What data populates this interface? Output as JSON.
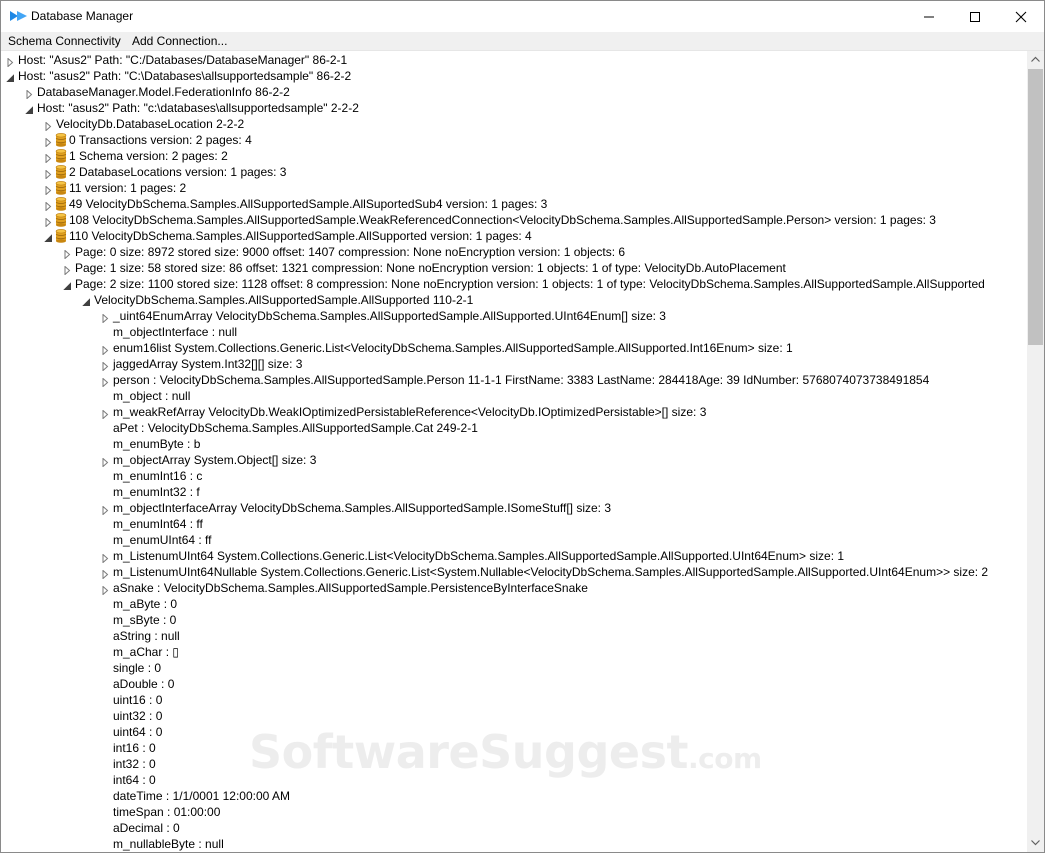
{
  "window": {
    "title": "Database Manager",
    "accent_color": "#1e88e5"
  },
  "menu": {
    "items": [
      "Schema Connectivity",
      "Add Connection..."
    ]
  },
  "tree": {
    "rows": [
      {
        "text": "Host: \"Asus2\" Path: \"C:/Databases/DatabaseManager\" 86-2-1",
        "level": 0,
        "toggle": "collapsed",
        "db": false
      },
      {
        "text": "Host: \"asus2\" Path: \"C:\\Databases\\allsupportedsample\" 86-2-2",
        "level": 0,
        "toggle": "expanded",
        "db": false
      },
      {
        "text": "DatabaseManager.Model.FederationInfo 86-2-2",
        "level": 1,
        "toggle": "collapsed",
        "db": false
      },
      {
        "text": "Host: \"asus2\" Path: \"c:\\databases\\allsupportedsample\" 2-2-2",
        "level": 1,
        "toggle": "expanded",
        "db": false
      },
      {
        "text": "VelocityDb.DatabaseLocation 2-2-2",
        "level": 2,
        "toggle": "collapsed",
        "db": false
      },
      {
        "text": "0 Transactions version: 2 pages: 4",
        "level": 2,
        "toggle": "collapsed",
        "db": true
      },
      {
        "text": "1 Schema version: 2 pages: 2",
        "level": 2,
        "toggle": "collapsed",
        "db": true
      },
      {
        "text": "2 DatabaseLocations version: 1 pages: 3",
        "level": 2,
        "toggle": "collapsed",
        "db": true
      },
      {
        "text": "11 version: 1 pages: 2",
        "level": 2,
        "toggle": "collapsed",
        "db": true
      },
      {
        "text": "49 VelocityDbSchema.Samples.AllSupportedSample.AllSuportedSub4 version: 1 pages: 3",
        "level": 2,
        "toggle": "collapsed",
        "db": true
      },
      {
        "text": "108 VelocityDbSchema.Samples.AllSupportedSample.WeakReferencedConnection<VelocityDbSchema.Samples.AllSupportedSample.Person> version: 1 pages: 3",
        "level": 2,
        "toggle": "collapsed",
        "db": true
      },
      {
        "text": "110 VelocityDbSchema.Samples.AllSupportedSample.AllSupported version: 1 pages: 4",
        "level": 2,
        "toggle": "expanded",
        "db": true
      },
      {
        "text": "Page: 0 size: 8972 stored size: 9000 offset: 1407 compression: None noEncryption version: 1  objects: 6",
        "level": 3,
        "toggle": "collapsed",
        "db": false
      },
      {
        "text": "Page: 1 size: 58 stored size: 86 offset: 1321 compression: None noEncryption version: 1  objects: 1  of type: VelocityDb.AutoPlacement",
        "level": 3,
        "toggle": "collapsed",
        "db": false
      },
      {
        "text": "Page: 2 size: 1100 stored size: 1128 offset: 8 compression: None noEncryption version: 1  objects: 1  of type: VelocityDbSchema.Samples.AllSupportedSample.AllSupported",
        "level": 3,
        "toggle": "expanded",
        "db": false
      },
      {
        "text": "VelocityDbSchema.Samples.AllSupportedSample.AllSupported 110-2-1",
        "level": 4,
        "toggle": "expanded",
        "db": false
      },
      {
        "text": "_uint64EnumArray VelocityDbSchema.Samples.AllSupportedSample.AllSupported.UInt64Enum[] size: 3",
        "level": 5,
        "toggle": "collapsed",
        "db": false
      },
      {
        "text": "m_objectInterface : null",
        "level": 5,
        "toggle": "none",
        "db": false
      },
      {
        "text": "enum16list System.Collections.Generic.List<VelocityDbSchema.Samples.AllSupportedSample.AllSupported.Int16Enum> size: 1",
        "level": 5,
        "toggle": "collapsed",
        "db": false
      },
      {
        "text": "jaggedArray System.Int32[][] size: 3",
        "level": 5,
        "toggle": "collapsed",
        "db": false
      },
      {
        "text": "person : VelocityDbSchema.Samples.AllSupportedSample.Person 11-1-1 FirstName: 3383 LastName: 284418Age: 39 IdNumber: 5768074073738491854",
        "level": 5,
        "toggle": "collapsed",
        "db": false
      },
      {
        "text": "m_object : null",
        "level": 5,
        "toggle": "none",
        "db": false
      },
      {
        "text": "m_weakRefArray VelocityDb.WeakIOptimizedPersistableReference<VelocityDb.IOptimizedPersistable>[] size: 3",
        "level": 5,
        "toggle": "collapsed",
        "db": false
      },
      {
        "text": "aPet : VelocityDbSchema.Samples.AllSupportedSample.Cat 249-2-1",
        "level": 5,
        "toggle": "none",
        "db": false
      },
      {
        "text": "m_enumByte : b",
        "level": 5,
        "toggle": "none",
        "db": false
      },
      {
        "text": "m_objectArray System.Object[] size: 3",
        "level": 5,
        "toggle": "collapsed",
        "db": false
      },
      {
        "text": "m_enumInt16 : c",
        "level": 5,
        "toggle": "none",
        "db": false
      },
      {
        "text": "m_enumInt32 : f",
        "level": 5,
        "toggle": "none",
        "db": false
      },
      {
        "text": "m_objectInterfaceArray VelocityDbSchema.Samples.AllSupportedSample.ISomeStuff[] size: 3",
        "level": 5,
        "toggle": "collapsed",
        "db": false
      },
      {
        "text": "m_enumInt64 : ff",
        "level": 5,
        "toggle": "none",
        "db": false
      },
      {
        "text": "m_enumUInt64 : ff",
        "level": 5,
        "toggle": "none",
        "db": false
      },
      {
        "text": "m_ListenumUInt64 System.Collections.Generic.List<VelocityDbSchema.Samples.AllSupportedSample.AllSupported.UInt64Enum> size: 1",
        "level": 5,
        "toggle": "collapsed",
        "db": false
      },
      {
        "text": "m_ListenumUInt64Nullable System.Collections.Generic.List<System.Nullable<VelocityDbSchema.Samples.AllSupportedSample.AllSupported.UInt64Enum>> size: 2",
        "level": 5,
        "toggle": "collapsed",
        "db": false
      },
      {
        "text": "aSnake : VelocityDbSchema.Samples.AllSupportedSample.PersistenceByInterfaceSnake",
        "level": 5,
        "toggle": "collapsed",
        "db": false
      },
      {
        "text": "m_aByte : 0",
        "level": 5,
        "toggle": "none",
        "db": false
      },
      {
        "text": "m_sByte : 0",
        "level": 5,
        "toggle": "none",
        "db": false
      },
      {
        "text": "aString : null",
        "level": 5,
        "toggle": "none",
        "db": false
      },
      {
        "text": "m_aChar : ▯",
        "level": 5,
        "toggle": "none",
        "db": false
      },
      {
        "text": "single : 0",
        "level": 5,
        "toggle": "none",
        "db": false
      },
      {
        "text": "aDouble : 0",
        "level": 5,
        "toggle": "none",
        "db": false
      },
      {
        "text": "uint16 : 0",
        "level": 5,
        "toggle": "none",
        "db": false
      },
      {
        "text": "uint32 : 0",
        "level": 5,
        "toggle": "none",
        "db": false
      },
      {
        "text": "uint64 : 0",
        "level": 5,
        "toggle": "none",
        "db": false
      },
      {
        "text": "int16 : 0",
        "level": 5,
        "toggle": "none",
        "db": false
      },
      {
        "text": "int32 : 0",
        "level": 5,
        "toggle": "none",
        "db": false
      },
      {
        "text": "int64 : 0",
        "level": 5,
        "toggle": "none",
        "db": false
      },
      {
        "text": "dateTime : 1/1/0001 12:00:00 AM",
        "level": 5,
        "toggle": "none",
        "db": false
      },
      {
        "text": "timeSpan : 01:00:00",
        "level": 5,
        "toggle": "none",
        "db": false
      },
      {
        "text": "aDecimal : 0",
        "level": 5,
        "toggle": "none",
        "db": false
      },
      {
        "text": "m_nullableByte : null",
        "level": 5,
        "toggle": "none",
        "db": false
      }
    ]
  },
  "watermark": {
    "main": "SoftwareSuggest",
    "suffix": ".com"
  },
  "icons": {
    "app": "database-manager-app-icon",
    "collapsed": "tree-collapsed-arrow-icon",
    "expanded": "tree-expanded-arrow-icon",
    "database": "database-cylinder-icon"
  }
}
